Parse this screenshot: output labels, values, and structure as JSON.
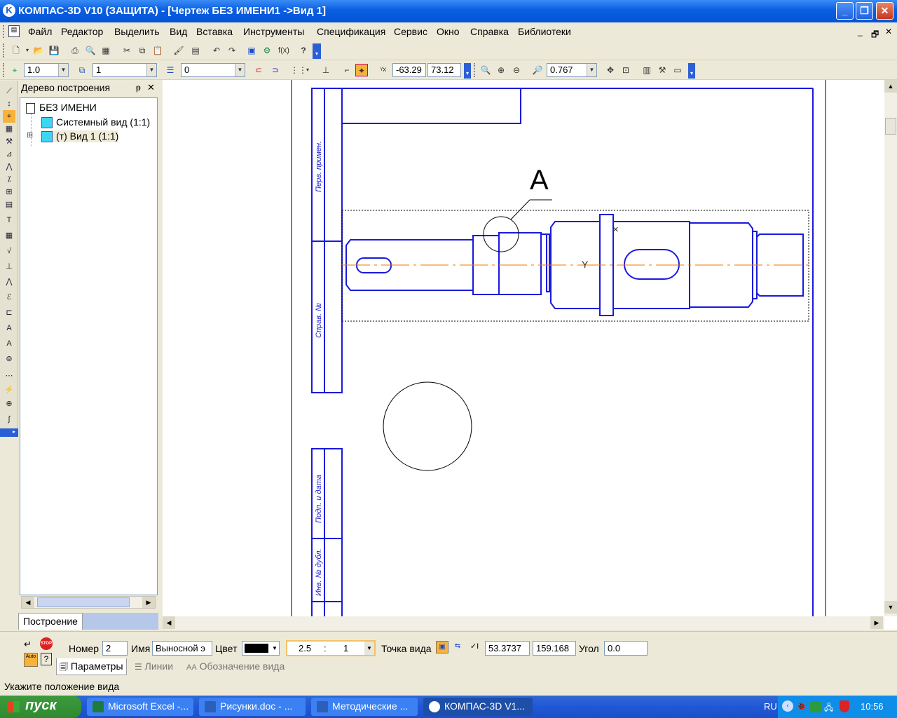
{
  "window": {
    "title": "КОМПАС-3D V10 (ЗАЩИТА) - [Чертеж БЕЗ ИМЕНИ1 ->Вид 1]",
    "minimize": "_",
    "maximize": "❐",
    "close": "✕"
  },
  "menu": [
    "Файл",
    "Редактор",
    "Выделить",
    "Вид",
    "Вставка",
    "Инструменты",
    "Спецификация",
    "Сервис",
    "Окно",
    "Справка",
    "Библиотеки"
  ],
  "mdi_controls": {
    "minimize": "_",
    "restore": "🗗",
    "close": "✕"
  },
  "toolbar2": {
    "scale": "1.0",
    "layer": "1",
    "style": "0",
    "x": "-63.29",
    "y": "73.12",
    "zoom": "0.767"
  },
  "tree": {
    "title": "Дерево построения",
    "pin": "ᵽ",
    "close": "✕",
    "root": "БЕЗ ИМЕНИ",
    "items": [
      "Системный вид (1:1)",
      "(т) Вид 1 (1:1)"
    ],
    "expander": "⊞",
    "tab": "Построение"
  },
  "drawing": {
    "callout_letter": "А",
    "stamp": [
      "Перв. примен.",
      "Справ. №",
      "Подп. и дата",
      "Инв. № дубл.",
      "№"
    ]
  },
  "props": {
    "number_label": "Номер",
    "number": "2",
    "name_label": "Имя",
    "name": "Выносной э",
    "color_label": "Цвет",
    "scale_a": "2.5",
    "scale_sep": ":",
    "scale_b": "1",
    "point_label": "Точка вида",
    "x": "53.3737",
    "y": "159.168",
    "angle_label": "Угол",
    "angle": "0.0",
    "tabs": [
      "Параметры",
      "Линии",
      "Обозначение вида"
    ],
    "auto": "Auto",
    "stop": "STOP"
  },
  "status": "Укажите положение вида",
  "taskbar": {
    "start": "пуск",
    "tasks": [
      "Microsoft Excel -...",
      "Рисунки.doc - ...",
      "Методические ...",
      "КОМПАС-3D V1..."
    ],
    "lang": "RU",
    "clock": "10:56"
  },
  "colors": {
    "accent": "#0a5ee0",
    "drawing_lines": "#1a1adc",
    "axis": "#f07800"
  }
}
